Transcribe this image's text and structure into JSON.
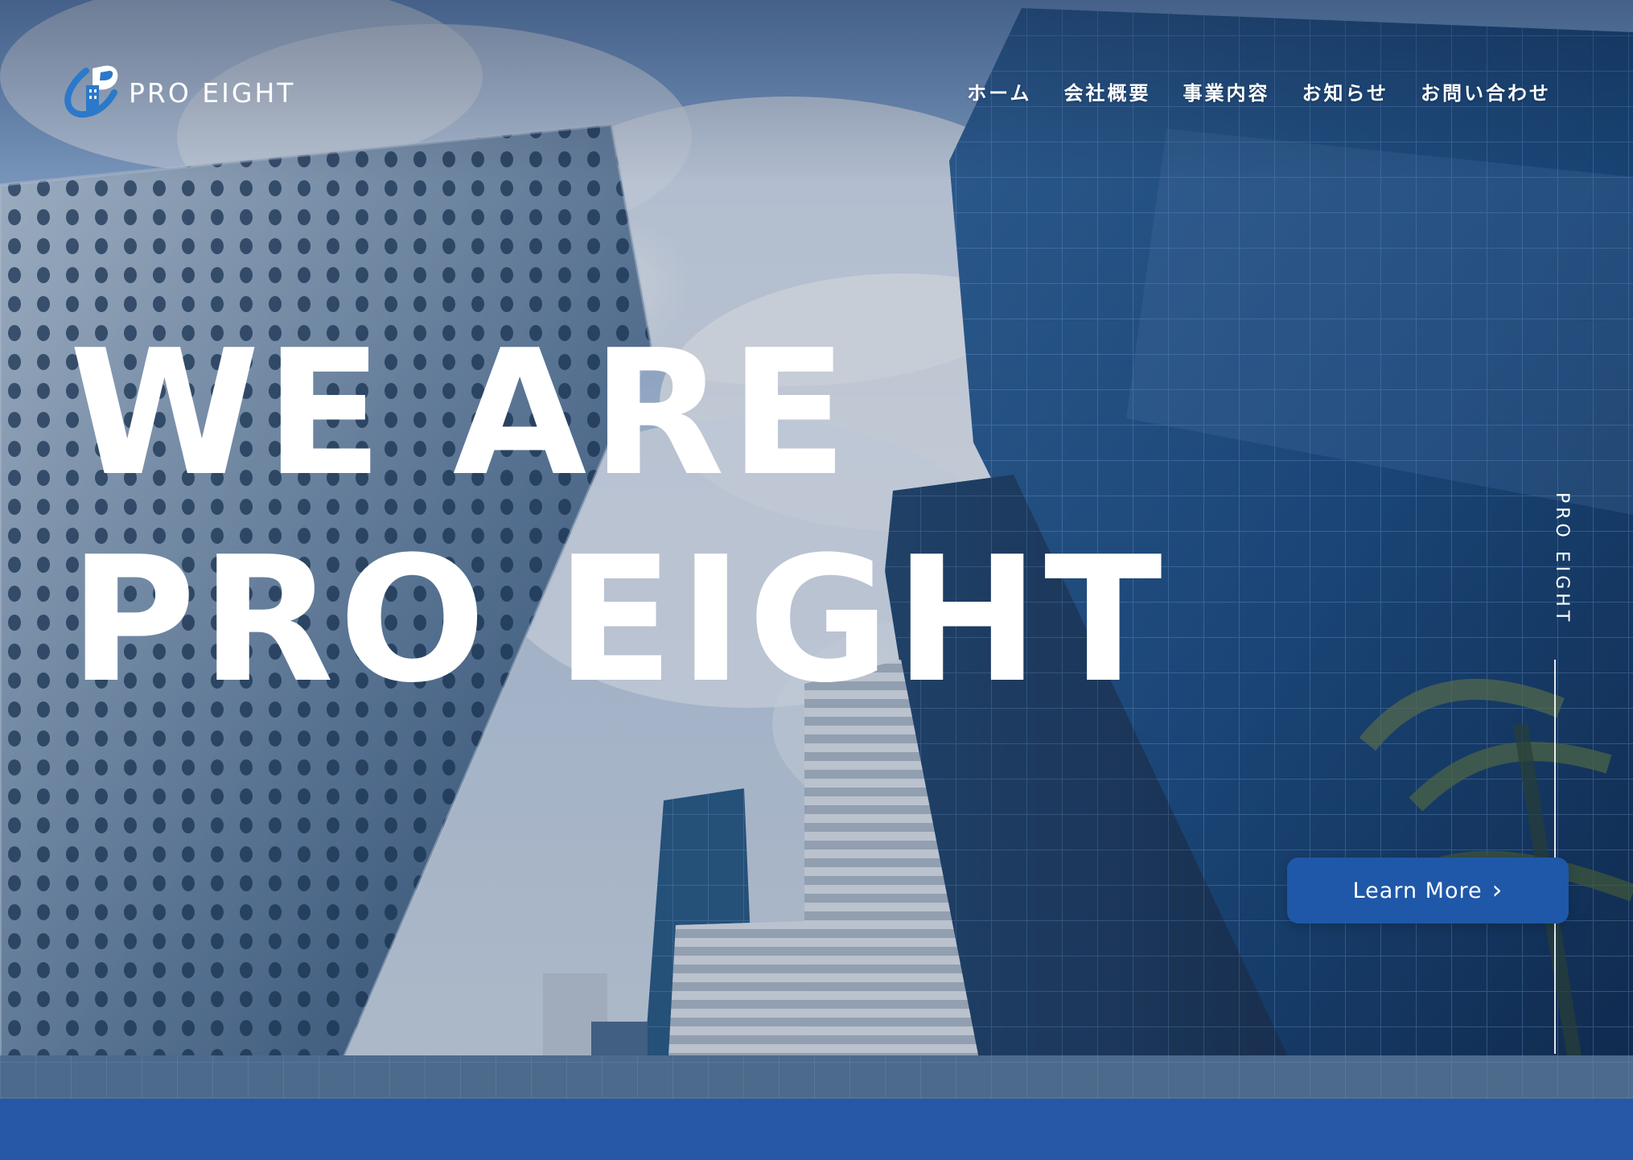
{
  "brand": {
    "logo_text": "PRO EIGHT",
    "logo_icon": "building-p-logo-icon",
    "accent": "#2658a8"
  },
  "nav": {
    "items": [
      {
        "label": "ホーム"
      },
      {
        "label": "会社概要"
      },
      {
        "label": "事業内容"
      },
      {
        "label": "お知らせ"
      },
      {
        "label": "お問い合わせ"
      }
    ]
  },
  "hero": {
    "headline_line1": "WE ARE",
    "headline_line2": "PRO EIGHT",
    "vertical_label": "PRO EIGHT",
    "cta_label": "Learn More",
    "cta_icon": "chevron-right-icon"
  },
  "colors": {
    "nav_text": "#ffffff",
    "button_bg": "#1f58a8",
    "band": "#2658a8"
  }
}
